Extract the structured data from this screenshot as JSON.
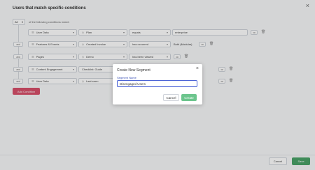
{
  "page": {
    "title": "Users that match specific conditions",
    "close_glyph": "×"
  },
  "match": {
    "selector_value": "All",
    "text": "of the following conditions match"
  },
  "conditions": [
    {
      "connector": "",
      "category": "User Data",
      "field": "Plan",
      "operator": "equals",
      "value": "enterprise"
    },
    {
      "connector": "and",
      "category": "Features & Events",
      "field": "Created Invoice",
      "operator": "has occurred",
      "value": "Both (Modular)"
    },
    {
      "connector": "and",
      "category": "Pages",
      "field": "Demo",
      "operator": "has been viewed",
      "value": ""
    },
    {
      "connector": "and",
      "category": "Content Engagement",
      "field": "Checklist: Guide",
      "operator": "",
      "value": ""
    },
    {
      "connector": "and",
      "category": "User Data",
      "field": "Last seen",
      "operator": "",
      "value": ""
    }
  ],
  "add_condition_label": "Add Condition",
  "footer": {
    "cancel_label": "Cancel",
    "save_label": "Save"
  },
  "modal": {
    "title": "Create New Segment",
    "close_glyph": "×",
    "field_label": "Segment Name",
    "field_value": "Disengaged Users",
    "cancel_label": "Cancel",
    "create_label": "Create"
  },
  "colors": {
    "accent_red": "#d8506a",
    "save_green": "#4aa268",
    "create_green": "#6cc58d",
    "focus_blue": "#4b63d6"
  },
  "icons": {
    "category": "user-icon",
    "field": "tag-icon",
    "dropdown": "chevron-down-icon",
    "more": "more-icon",
    "delete": "trash-icon"
  }
}
